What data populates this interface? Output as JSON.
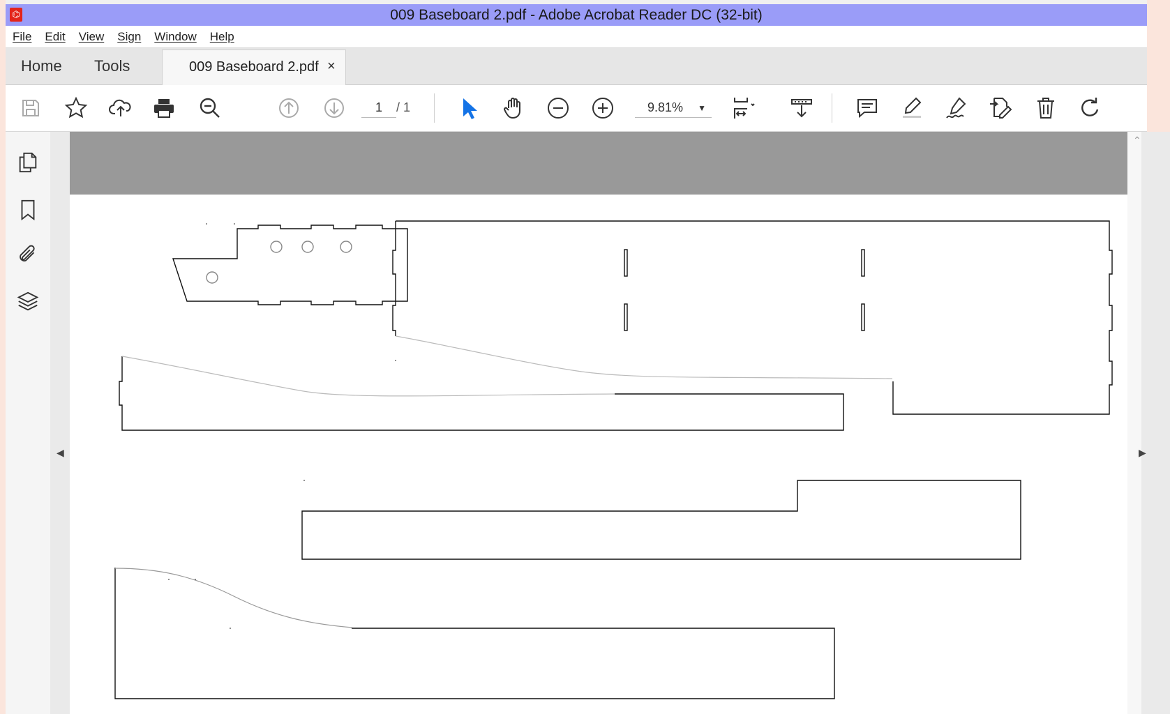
{
  "window": {
    "title": "009 Baseboard 2.pdf - Adobe Acrobat Reader DC (32-bit)"
  },
  "menu": [
    "File",
    "Edit",
    "View",
    "Sign",
    "Window",
    "Help"
  ],
  "tabs": {
    "home": "Home",
    "tools": "Tools",
    "document": "009 Baseboard 2.pdf",
    "close_glyph": "×"
  },
  "toolbar": {
    "page_current": "1",
    "page_total": "/ 1",
    "zoom": "9.81%",
    "icons": [
      "save-icon",
      "star-icon",
      "upload-icon",
      "print-icon",
      "search-icon",
      "page-up-icon",
      "page-down-icon",
      "select-cursor-icon",
      "hand-icon",
      "zoom-out-icon",
      "zoom-in-icon",
      "fit-page-icon",
      "scroll-mode-icon",
      "comment-icon",
      "highlight-icon",
      "sign-icon",
      "edit-pdf-icon",
      "delete-icon",
      "rotate-icon"
    ]
  },
  "siderail": {
    "icons": [
      "pages-icon",
      "bookmark-icon",
      "attachment-icon",
      "layers-icon"
    ]
  },
  "colors": {
    "titlebar": "#9a9cf8",
    "accent": "#1473e6",
    "page_gray": "#999999"
  }
}
